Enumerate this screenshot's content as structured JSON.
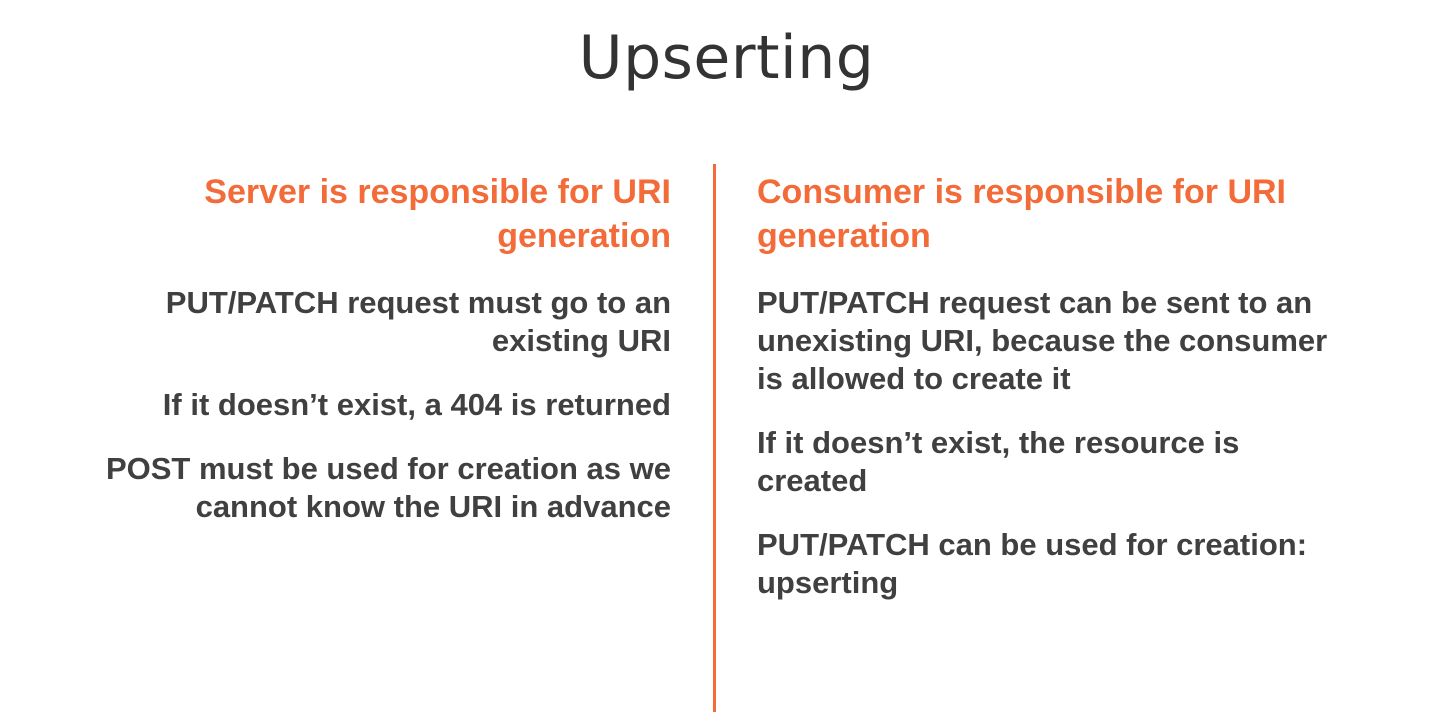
{
  "slide": {
    "title": "Upserting"
  },
  "left": {
    "heading_line1": "Server is responsible for URI",
    "heading_line2": "generation",
    "points": [
      {
        "line1": "PUT/PATCH request must go to an",
        "line2": "existing URI"
      },
      {
        "line1": "If it doesn’t exist, a 404 is returned"
      },
      {
        "line1": "POST must be used for creation as we",
        "line2": "cannot know the URI in advance"
      }
    ]
  },
  "right": {
    "heading_line1": "Consumer is responsible for URI",
    "heading_line2": "generation",
    "points": [
      {
        "line1": "PUT/PATCH request can be sent to an",
        "line2": "unexisting URI, because the consumer",
        "line3": "is allowed to create it"
      },
      {
        "line1": "If it doesn’t exist, the resource is",
        "line2": "created"
      },
      {
        "line1": "PUT/PATCH can be used for creation:",
        "line2": "upserting"
      }
    ]
  },
  "colors": {
    "accent": "#f26b38",
    "text": "#404040",
    "title": "#333333"
  }
}
